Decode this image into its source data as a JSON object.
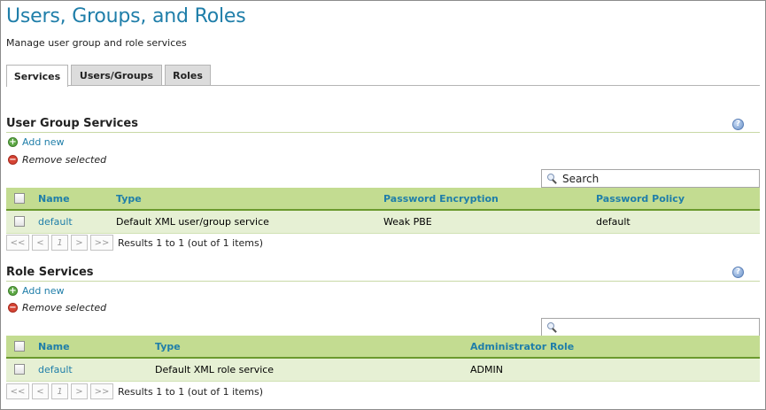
{
  "header": {
    "title": "Users, Groups, and Roles",
    "description": "Manage user group and role services"
  },
  "tabs": [
    {
      "label": "Services",
      "active": true
    },
    {
      "label": "Users/Groups",
      "active": false
    },
    {
      "label": "Roles",
      "active": false
    }
  ],
  "icons": {
    "help": "help-icon",
    "add": "add-icon",
    "remove": "remove-icon",
    "search": "search-icon"
  },
  "user_group_services": {
    "title": "User Group Services",
    "add_label": "Add new",
    "remove_label": "Remove selected",
    "search_placeholder": "Search",
    "columns": [
      "Name",
      "Type",
      "Password Encryption",
      "Password Policy"
    ],
    "rows": [
      {
        "name": "default",
        "type": "Default XML user/group service",
        "password_encryption": "Weak PBE",
        "password_policy": "default"
      }
    ],
    "pager": {
      "first": "<<",
      "prev": "<",
      "page": "1",
      "next": ">",
      "last": ">>",
      "results": "Results 1 to 1 (out of 1 items)"
    }
  },
  "role_services": {
    "title": "Role Services",
    "add_label": "Add new",
    "remove_label": "Remove selected",
    "search_placeholder": "",
    "columns": [
      "Name",
      "Type",
      "Administrator Role"
    ],
    "rows": [
      {
        "name": "default",
        "type": "Default XML role service",
        "admin_role": "ADMIN"
      }
    ],
    "pager": {
      "first": "<<",
      "prev": "<",
      "page": "1",
      "next": ">",
      "last": ">>",
      "results": "Results 1 to 1 (out of 1 items)"
    }
  },
  "colors": {
    "accent": "#1f7ea9",
    "grid_header": "#c3dc91",
    "grid_row": "#e6f0d4",
    "add": "#5ea945",
    "remove": "#d64434"
  }
}
